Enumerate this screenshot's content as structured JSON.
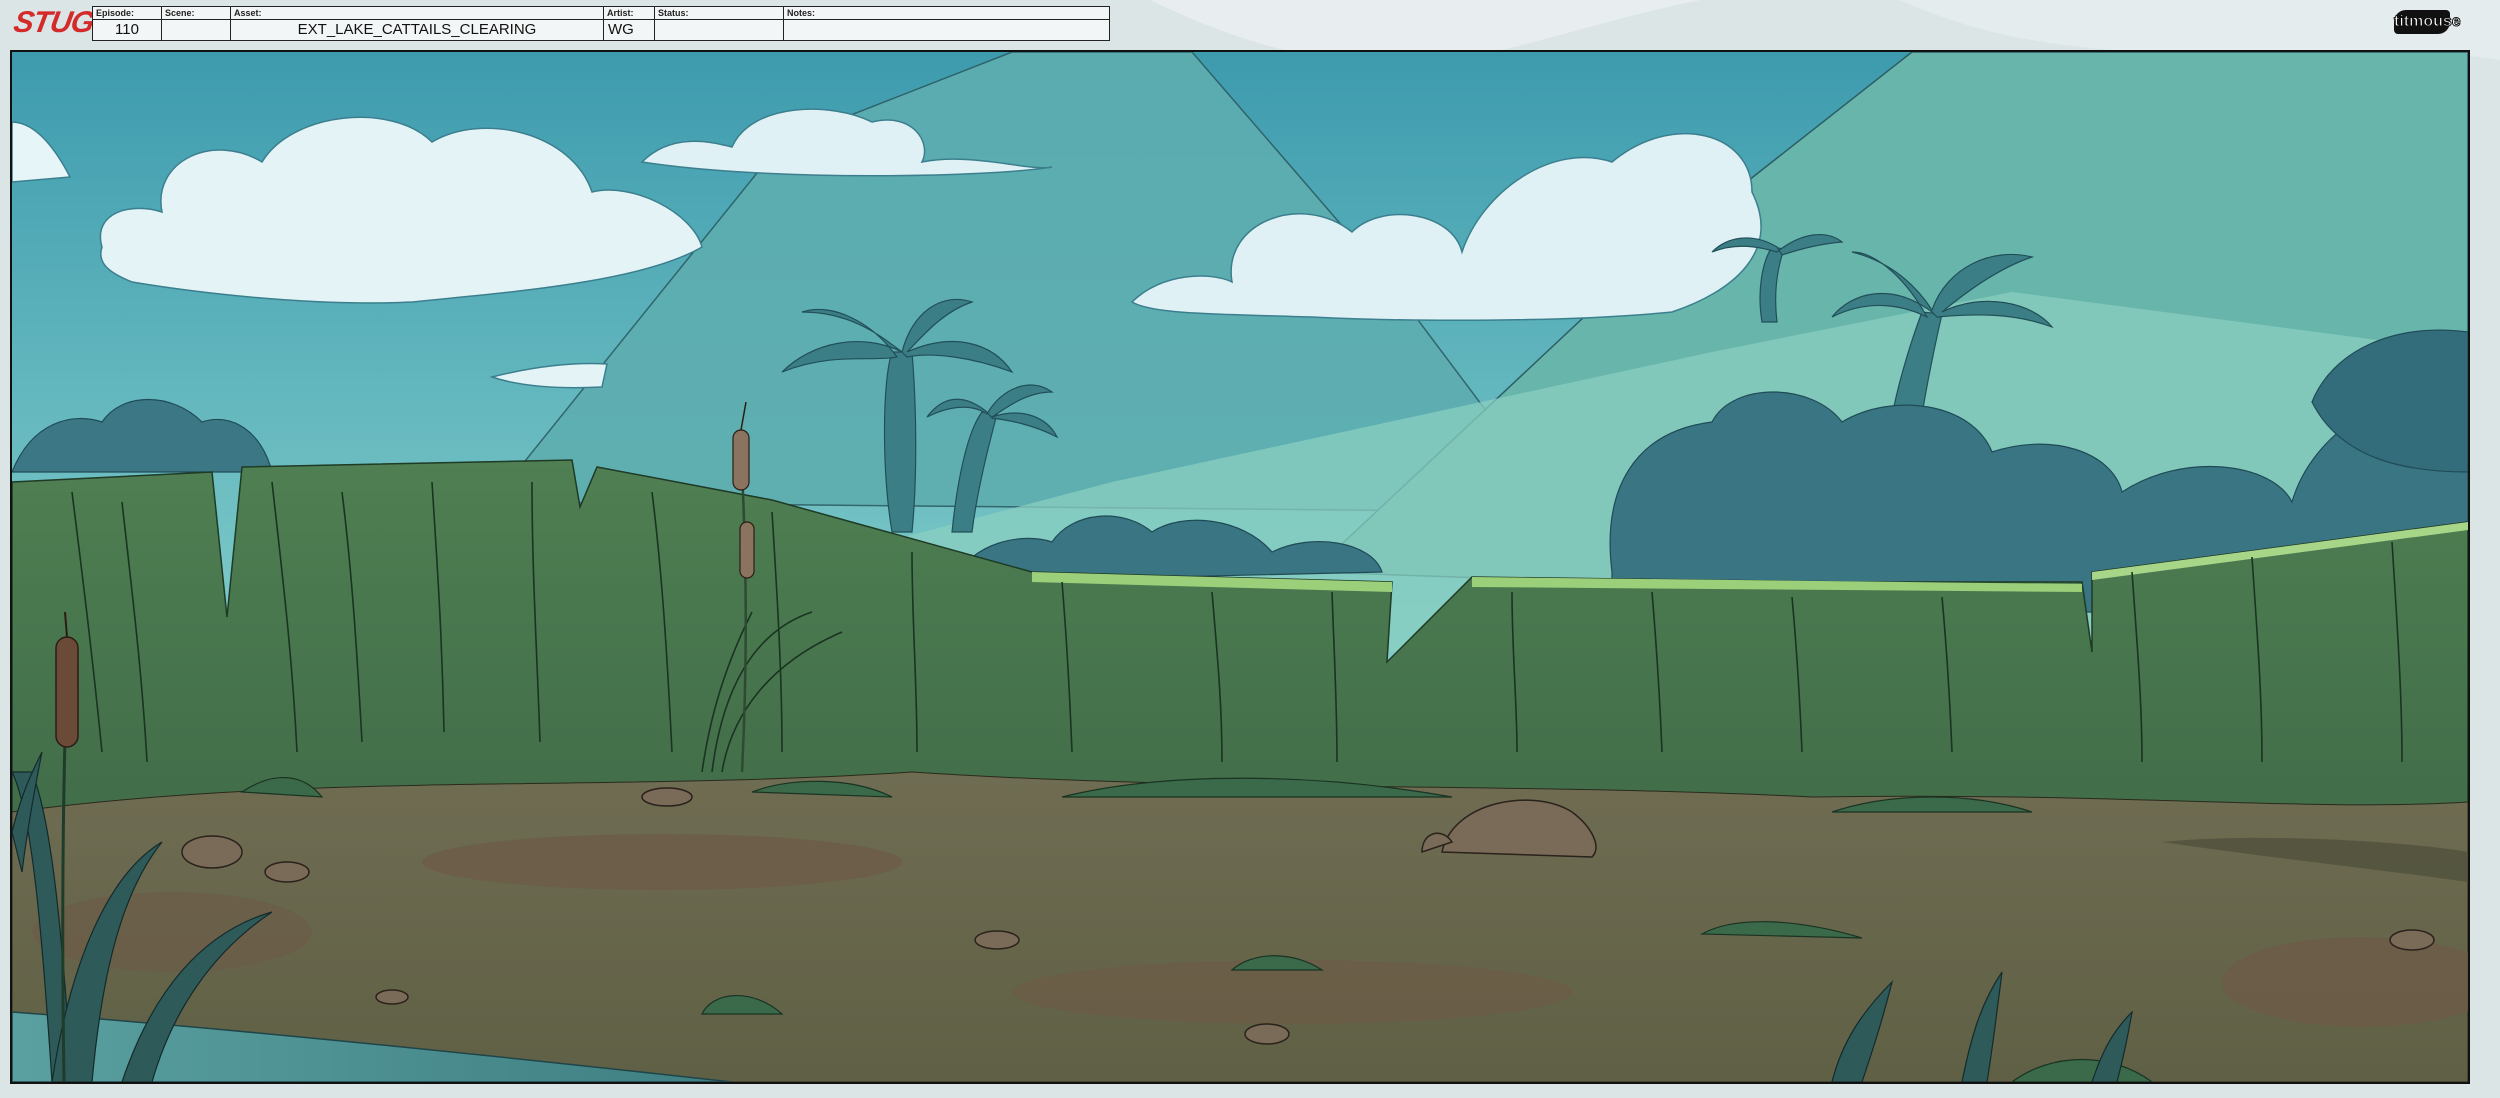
{
  "logo": {
    "text": "STUGo"
  },
  "studio_logo": {
    "text": "titmouse"
  },
  "slate": {
    "fields": [
      {
        "label": "Episode:",
        "value": "110"
      },
      {
        "label": "Scene:",
        "value": ""
      },
      {
        "label": "Asset:",
        "value": "EXT_LAKE_CATTAILS_CLEARING"
      },
      {
        "label": "Artist:",
        "value": "WG"
      },
      {
        "label": "Status:",
        "value": ""
      },
      {
        "label": "Notes:",
        "value": ""
      }
    ]
  },
  "colors": {
    "sky_top": "#3d9bae",
    "sky_bottom": "#a9e1dc",
    "mountain": "#6bb7b4",
    "grass": "#4c7a4e",
    "ground": "#6e6b52",
    "water": "#4d8e90",
    "logo_red": "#d42a2a"
  }
}
